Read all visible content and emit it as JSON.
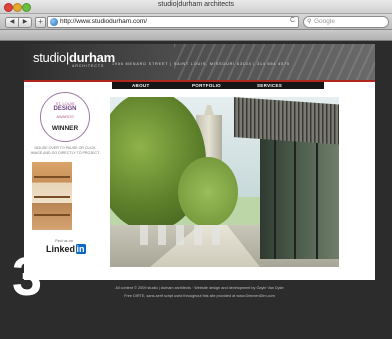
{
  "window": {
    "title": "studio|durham architects"
  },
  "toolbar": {
    "back_glyph": "◀",
    "forward_glyph": "▶",
    "add_glyph": "+",
    "url": "http://www.studiodurham.com/",
    "reload_glyph": "C",
    "search_placeholder": "Google"
  },
  "site": {
    "logo_light": "studio",
    "logo_bold": "durham",
    "logo_sub": "ARCHITECTS",
    "address": "1956 MENARD STREET  |  SAINT LOUIS, MISSOURI 63104  |  314 664 4575",
    "nav": [
      "ABOUT",
      "PORTFOLIO",
      "SERVICES"
    ]
  },
  "sidebar": {
    "award_line1": "ST. LOUIS",
    "award_line2": "DESIGN",
    "award_line3": "AWARDS",
    "award_winner": "WINNER",
    "mouse_text": "MOUSE OVER TO PAUSE OR CLICK IMAGE AND GO DIRECTLY TO PROJECT",
    "find_us": "Find us on",
    "linkedin_text": "Linked",
    "linkedin_in": "in"
  },
  "footer": {
    "line1": "All content © 2009 studio | durham architects  ·  Website design and development by Gayle Van Dyke",
    "line2": "Free DIRTE, sans-serif script used throughout this site provided at www.DimmenDIm.com"
  },
  "overlay": {
    "number": "3"
  },
  "colors": {
    "accent_red": "#b0261f",
    "linkedin_blue": "#0a66c2",
    "award_purple": "#6d3f7d"
  }
}
